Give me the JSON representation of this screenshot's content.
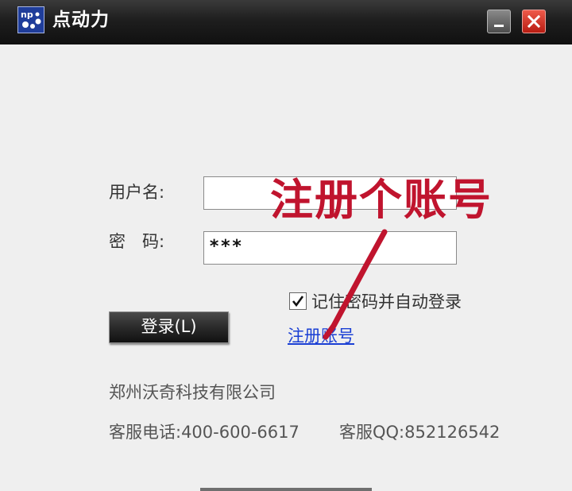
{
  "window": {
    "title": "点动力",
    "minimize_icon": "minimize-icon",
    "close_icon": "close-icon",
    "app_icon": "app-logo-icon",
    "colors": {
      "titlebar": "#1a1a1a",
      "close": "#d8281b",
      "link": "#1a3fd4",
      "annotation": "#c0142e"
    }
  },
  "form": {
    "username_label": "用户名:",
    "username_value": "",
    "password_label": "密　码:",
    "password_value": "***",
    "remember_checked": true,
    "remember_label": "记住密码并自动登录",
    "login_button": "登录(L)",
    "register_link": "注册账号"
  },
  "footer": {
    "company": "郑州沃奇科技有限公司",
    "hotline": "客服电话:400-600-6617",
    "qq": "客服QQ:852126542"
  },
  "annotation": {
    "text": "注册个账号"
  }
}
